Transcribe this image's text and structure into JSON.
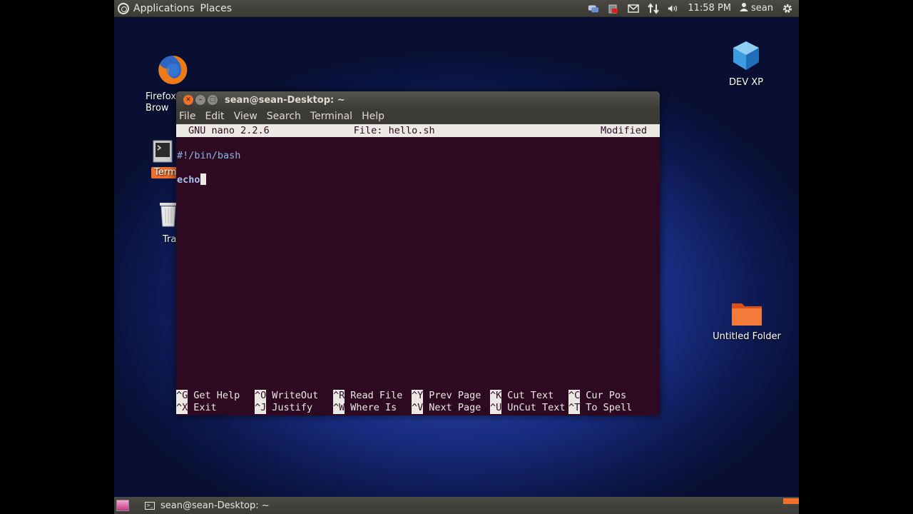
{
  "top_panel": {
    "menus": [
      "Applications",
      "Places"
    ],
    "clock": "11:58 PM",
    "user": "sean",
    "tray_icons": [
      "chat-icon",
      "battery-icon",
      "mail-icon",
      "network-icon",
      "volume-icon"
    ]
  },
  "desktop_icons": [
    {
      "name": "firefox",
      "label": "Firefox Web Browser",
      "visible_label": "Firefox\nBrow"
    },
    {
      "name": "terminal",
      "visible_label": "Term"
    },
    {
      "name": "trash",
      "visible_label": "Tra"
    },
    {
      "name": "dev-xp",
      "label": "DEV XP"
    },
    {
      "name": "untitled-folder",
      "label": "Untitled Folder"
    }
  ],
  "window": {
    "title": "sean@sean-Desktop: ~",
    "menu": [
      "File",
      "Edit",
      "View",
      "Search",
      "Terminal",
      "Help"
    ]
  },
  "nano": {
    "version": "GNU nano 2.2.6",
    "file": "File: hello.sh",
    "status": "Modified",
    "lines": [
      "#!/bin/bash",
      "echo"
    ],
    "shortcuts_row1": [
      {
        "key": "^G",
        "label": "Get Help"
      },
      {
        "key": "^O",
        "label": "WriteOut"
      },
      {
        "key": "^R",
        "label": "Read File"
      },
      {
        "key": "^Y",
        "label": "Prev Page"
      },
      {
        "key": "^K",
        "label": "Cut Text"
      },
      {
        "key": "^C",
        "label": "Cur Pos"
      }
    ],
    "shortcuts_row2": [
      {
        "key": "^X",
        "label": "Exit"
      },
      {
        "key": "^J",
        "label": "Justify"
      },
      {
        "key": "^W",
        "label": "Where Is"
      },
      {
        "key": "^V",
        "label": "Next Page"
      },
      {
        "key": "^U",
        "label": "UnCut Text"
      },
      {
        "key": "^T",
        "label": "To Spell"
      }
    ]
  },
  "bottom_panel": {
    "task": "sean@sean-Desktop: ~"
  }
}
